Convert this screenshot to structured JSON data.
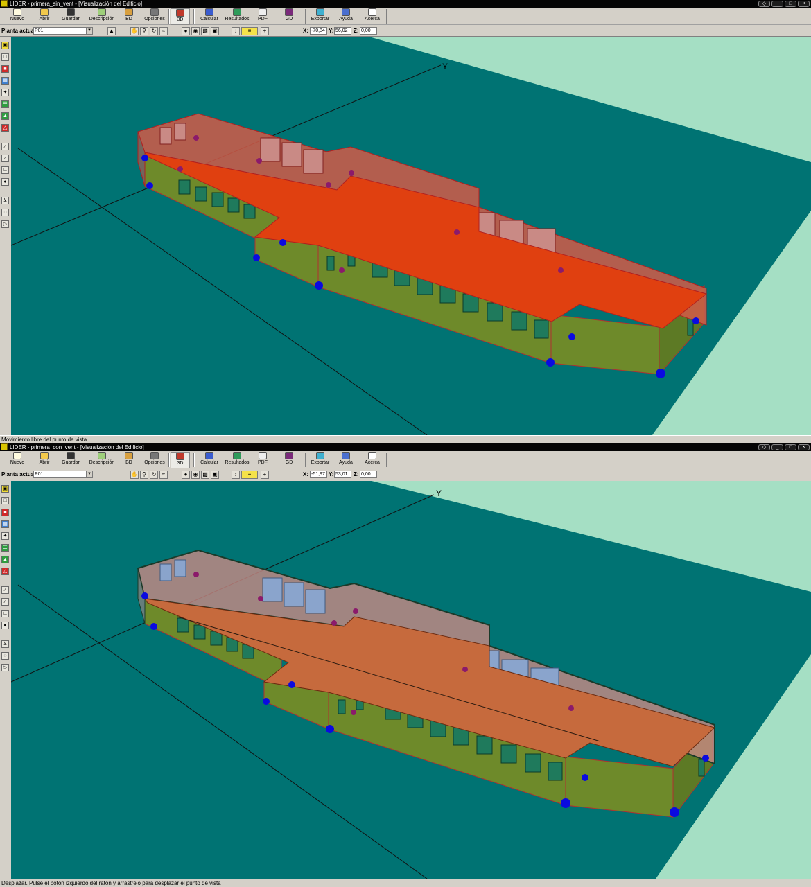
{
  "windows": [
    {
      "title": "LIDER - primera_sin_vent - [Visualización del Edificio]",
      "toolbar": {
        "nuevo": "Nuevo",
        "abrir": "Abrir",
        "guardar": "Guardar",
        "descripcion": "Descripción",
        "bd": "BD",
        "opciones": "Opciones",
        "view3d": "3D",
        "calcular": "Calcular",
        "resultados": "Resultados",
        "pdf": "PDF",
        "gd": "GD",
        "exportar": "Exportar",
        "ayuda": "Ayuda",
        "acerca": "Acerca"
      },
      "floor_label": "Planta actual",
      "floor_value": "P01",
      "x_label": "X:",
      "x_value": "-70,84",
      "y_label": "Y:",
      "y_value": "56,02",
      "z_label": "Z:",
      "z_value": "0,00",
      "axis_label": "Y",
      "status": "Movimiento libre del punto de vista"
    },
    {
      "title": "LIDER - primera_con_vent - [Visualización del Edificio]",
      "toolbar": {
        "nuevo": "Nuevo",
        "abrir": "Abrir",
        "guardar": "Guardar",
        "descripcion": "Descripción",
        "bd": "BD",
        "opciones": "Opciones",
        "view3d": "3D",
        "calcular": "Calcular",
        "resultados": "Resultados",
        "pdf": "PDF",
        "gd": "GD",
        "exportar": "Exportar",
        "ayuda": "Ayuda",
        "acerca": "Acerca"
      },
      "floor_label": "Planta actual",
      "floor_value": "P01",
      "x_label": "X:",
      "x_value": "-51,97",
      "y_label": "Y:",
      "y_value": "53,01",
      "z_label": "Z:",
      "z_value": "0,00",
      "axis_label": "Y",
      "status": "Desplazar. Pulse el botón izquierdo del ratón y arrástrelo para desplazar el punto de vista"
    }
  ],
  "colors": {
    "ground": "#007373",
    "background": "#a5dfc4",
    "walls": "#6e8a2a",
    "roof_top": "#e04010",
    "upper_top": "#d25a48",
    "roof_bottom": "#c66a3d",
    "upper_bottom": "#c98a85",
    "window_green": "#1f7a5c",
    "window_blue": "#8aa4cc",
    "node": "#0a0ae0"
  }
}
